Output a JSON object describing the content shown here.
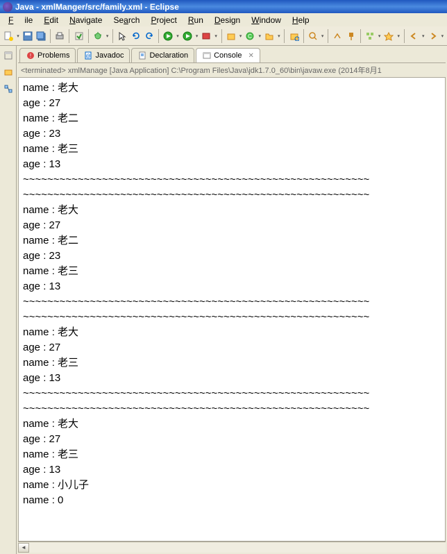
{
  "window": {
    "title": "Java - xmlManger/src/family.xml - Eclipse"
  },
  "menu": {
    "file": "File",
    "edit": "Edit",
    "navigate": "Navigate",
    "search": "Search",
    "project": "Project",
    "run": "Run",
    "design": "Design",
    "window": "Window",
    "help": "Help"
  },
  "tabs": {
    "problems": "Problems",
    "javadoc": "Javadoc",
    "declaration": "Declaration",
    "console": "Console",
    "close": "✕"
  },
  "status": "<terminated> xmlManage [Java Application] C:\\Program Files\\Java\\jdk1.7.0_60\\bin\\javaw.exe  (2014年8月1",
  "sep": "~~~~~~~~~~~~~~~~~~~~~~~~~~~~~~~~~~~~~~~~~~~~~~~~~~~~~~~~~",
  "output": {
    "b1": [
      "name : 老大",
      "age : 27",
      "name : 老二",
      "age : 23",
      "name : 老三",
      "age : 13"
    ],
    "b2": [
      "name : 老大",
      "age : 27",
      "name : 老二",
      "age : 23",
      "name : 老三",
      "age : 13"
    ],
    "b3": [
      "name : 老大",
      "age : 27",
      "name : 老三",
      "age : 13"
    ],
    "b4": [
      "name : 老大",
      "age : 27",
      "name : 老三",
      "age : 13",
      "name : 小儿子",
      "name : 0"
    ]
  }
}
